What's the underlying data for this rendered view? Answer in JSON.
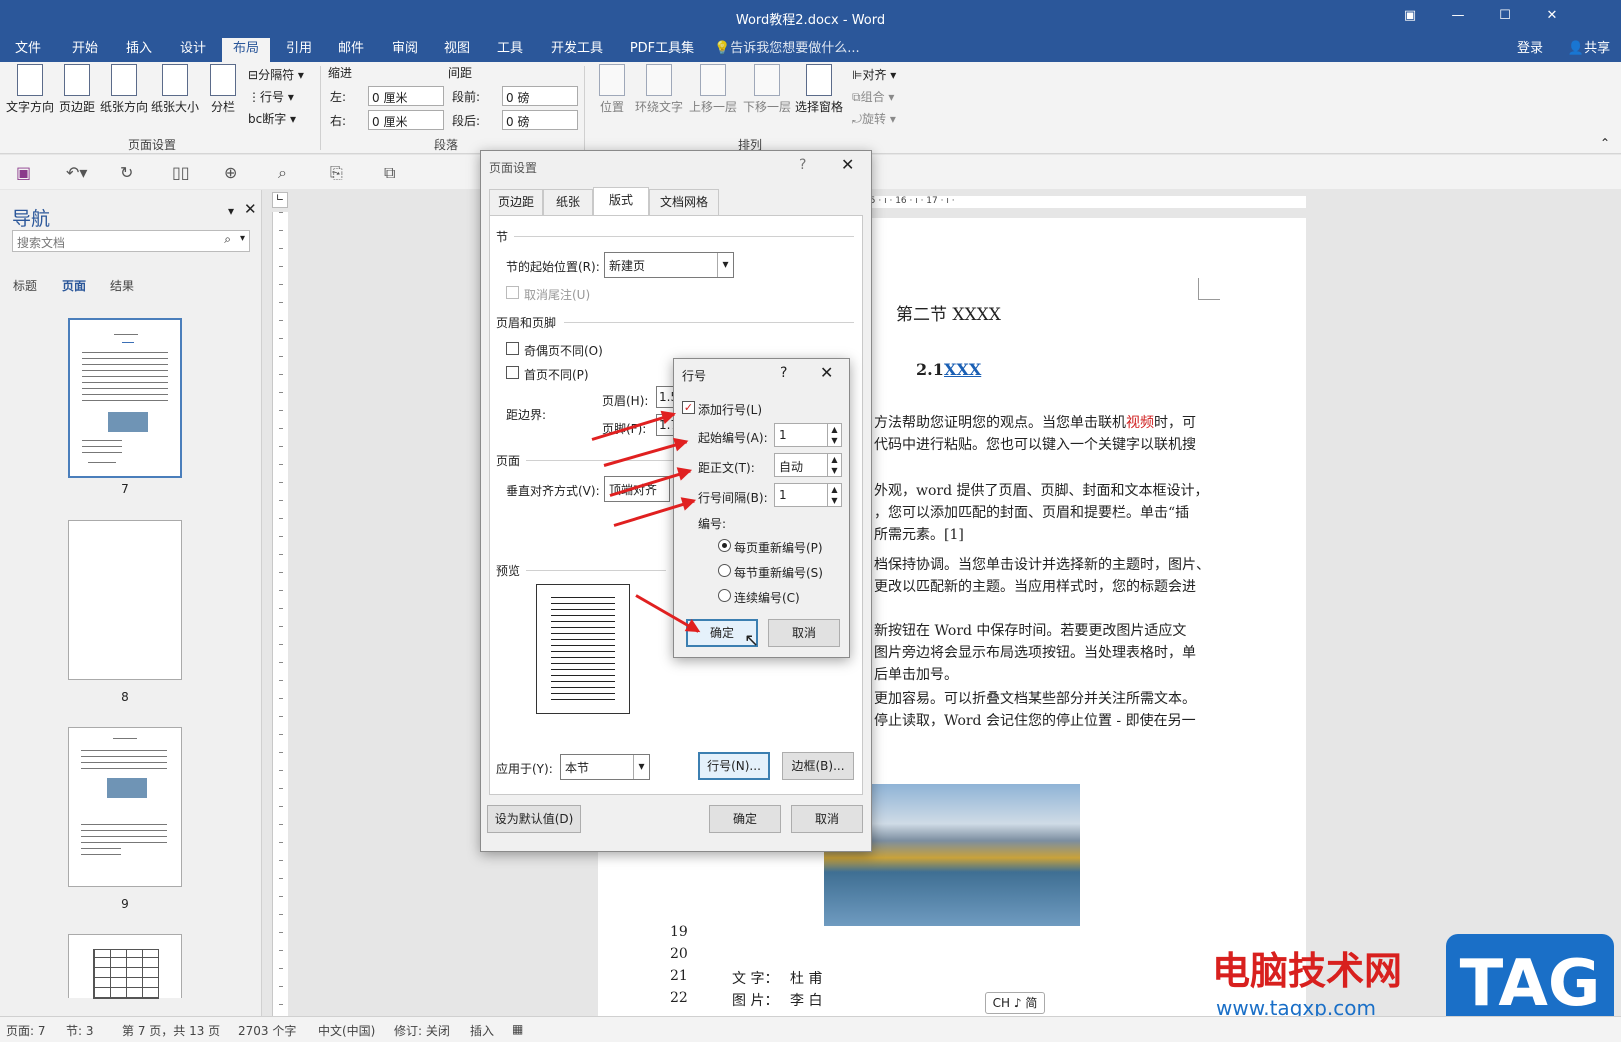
{
  "app": {
    "title": "Word教程2.docx - Word",
    "login": "登录",
    "share": "共享"
  },
  "tabs": [
    "文件",
    "开始",
    "插入",
    "设计",
    "布局",
    "引用",
    "邮件",
    "审阅",
    "视图",
    "工具",
    "开发工具",
    "PDF工具集"
  ],
  "tell_me": "告诉我您想要做什么...",
  "ribbon": {
    "text_direction": "文字方向",
    "margins": "页边距",
    "orientation": "纸张方向",
    "size": "纸张大小",
    "columns": "分栏",
    "breaks": "分隔符",
    "line_numbers": "行号",
    "hyphenation": "断字",
    "group_page_setup": "页面设置",
    "indent_label": "缩进",
    "indent_left_label": "左:",
    "indent_left": "0 厘米",
    "indent_right_label": "右:",
    "indent_right": "0 厘米",
    "spacing_label": "间距",
    "spacing_before_label": "段前:",
    "spacing_before": "0 磅",
    "spacing_after_label": "段后:",
    "spacing_after": "0 磅",
    "group_paragraph": "段落",
    "position": "位置",
    "wrap_text": "环绕文字",
    "bring_forward": "上移一层",
    "send_backward": "下移一层",
    "selection_pane": "选择窗格",
    "align": "对齐",
    "group": "组合",
    "rotate": "旋转",
    "group_arrange": "排列"
  },
  "nav": {
    "title": "导航",
    "search_placeholder": "搜索文档",
    "tabs": [
      "标题",
      "页面",
      "结果"
    ],
    "pages": [
      "7",
      "8",
      "9"
    ]
  },
  "ruler_h": "· 6 · ı · 7 · ı · 8 · ı · 9 · ı · 10 · ı · 11 · ı · 12 · ı · 13 · ı · 14 · ı ▲15 · ı · 16 · ı · 17 · ı ·",
  "document": {
    "heading": "第二节  XXXX",
    "subheading_num": "2.1",
    "subheading_link": "XXX",
    "lines": [
      "方法帮助您证明您的观点。当您单击联机视频时，可",
      "代码中进行粘贴。您也可以键入一个关键字以联机搜",
      "外观，word 提供了页眉、页脚、封面和文本框设计，",
      "，您可以添加匹配的封面、页眉和提要栏。单击“插",
      "所需元素。[1]",
      "档保持协调。当您单击设计并选择新的主题时，图片、",
      "更改以匹配新的主题。当应用样式时，您的标题会进",
      "新按钮在 Word 中保存时间。若要更改图片适应文",
      "图片旁边将会显示布局选项按钮。当处理表格时，单",
      "后单击加号。",
      "更加容易。可以折叠文档某些部分并关注所需文本。",
      "停止读取，Word 会记住您的停止位置 - 即使在另一"
    ],
    "highlight_word": "视频",
    "line_numbers": [
      "19",
      "20",
      "21",
      "22"
    ],
    "table_rows": [
      {
        "label": "文  字：",
        "value": "杜    甫"
      },
      {
        "label": "图  片：",
        "value": "李    白"
      }
    ]
  },
  "statusbar": {
    "page": "页面: 7",
    "section": "节: 3",
    "page_of": "第 7 页，共 13 页",
    "words": "2703 个字",
    "lang": "中文(中国)",
    "track": "修订: 关闭",
    "insert": "插入"
  },
  "ime": "CH ♪ 简",
  "watermark": {
    "title": "电脑技术网",
    "url": "www.tagxp.com",
    "logo": "TAG"
  },
  "page_setup": {
    "title": "页面设置",
    "help": "?",
    "tabs": [
      "页边距",
      "纸张",
      "版式",
      "文档网格"
    ],
    "section_label": "节",
    "section_start_label": "节的起始位置(R):",
    "section_start_value": "新建页",
    "suppress_endnotes": "取消尾注(U)",
    "header_footer_label": "页眉和页脚",
    "odd_even": "奇偶页不同(O)",
    "first_page": "首页不同(P)",
    "from_edge": "距边界:",
    "header_label": "页眉(H):",
    "header_value": "1.5",
    "footer_label": "页脚(F):",
    "footer_value": "1.7",
    "page_label": "页面",
    "valign_label": "垂直对齐方式(V):",
    "valign_value": "顶端对齐",
    "preview_label": "预览",
    "apply_to_label": "应用于(Y):",
    "apply_to_value": "本节",
    "line_numbers_btn": "行号(N)...",
    "borders_btn": "边框(B)...",
    "set_default": "设为默认值(D)",
    "ok": "确定",
    "cancel": "取消"
  },
  "line_numbers_dialog": {
    "title": "行号",
    "help": "?",
    "add_line_numbers": "添加行号(L)",
    "start_at_label": "起始编号(A):",
    "start_at_value": "1",
    "from_text_label": "距正文(T):",
    "from_text_value": "自动",
    "count_by_label": "行号间隔(B):",
    "count_by_value": "1",
    "numbering_label": "编号:",
    "restart_page": "每页重新编号(P)",
    "restart_section": "每节重新编号(S)",
    "continuous": "连续编号(C)",
    "ok": "确定",
    "cancel": "取消"
  },
  "colors": {
    "brand": "#2b579a",
    "arrow": "#e02020",
    "watermark_red": "#d8201e",
    "watermark_blue": "#1a6fc7"
  }
}
